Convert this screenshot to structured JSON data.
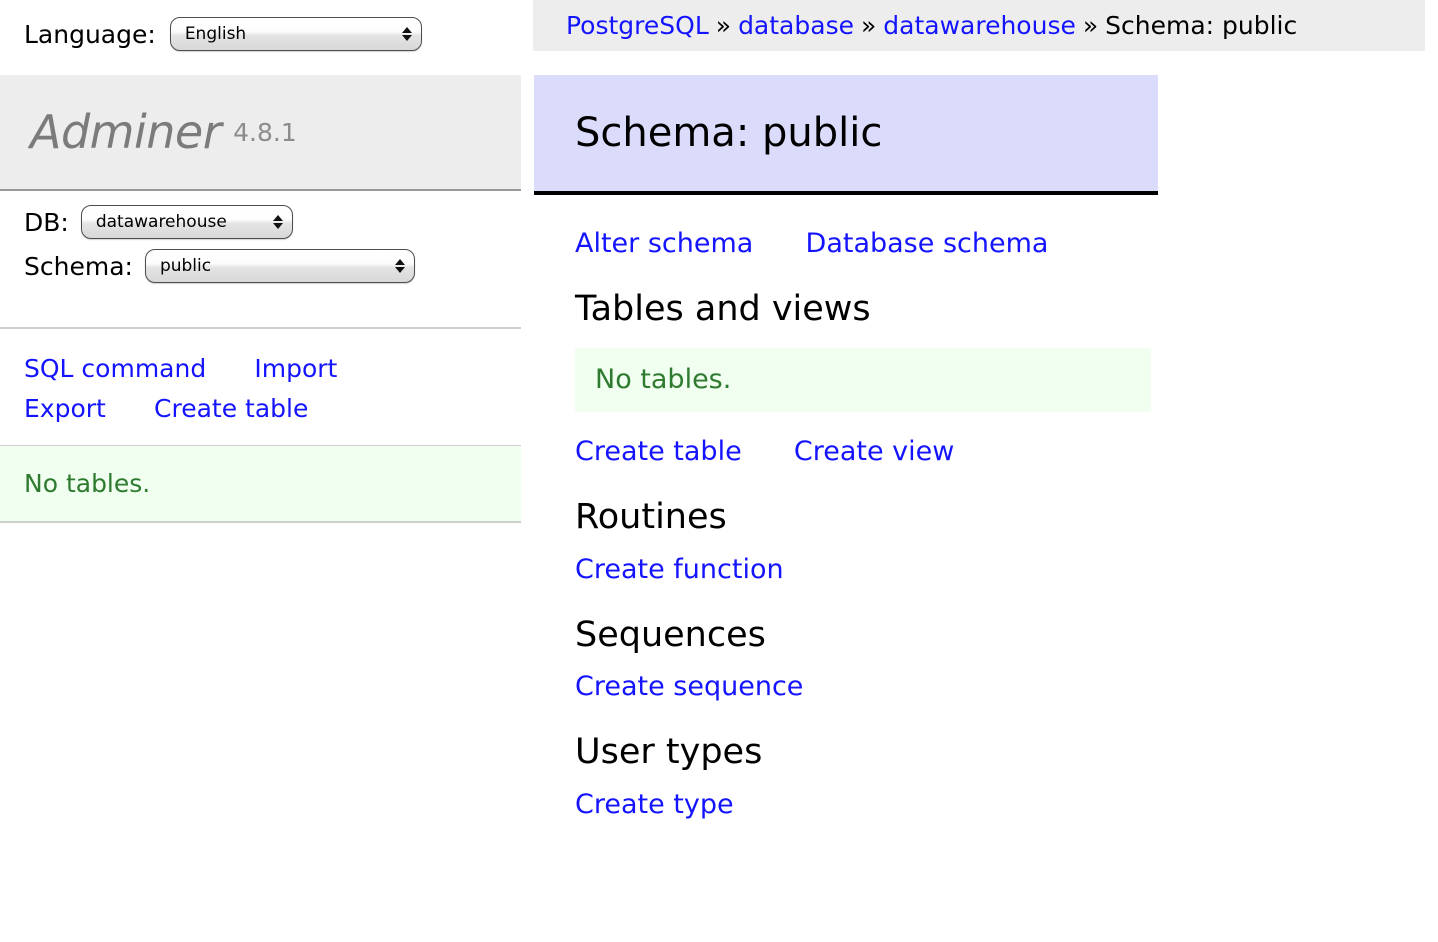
{
  "language_bar": {
    "label": "Language:",
    "select": {
      "value": "English",
      "icon": "updown-arrows-icon"
    }
  },
  "sidebar": {
    "brand": {
      "name": "Adminer",
      "version": "4.8.1"
    },
    "db": {
      "label": "DB:",
      "select": {
        "value": "datawarehouse",
        "icon": "updown-arrows-icon"
      }
    },
    "schema": {
      "label": "Schema:",
      "select": {
        "value": "public",
        "icon": "updown-arrows-icon"
      }
    },
    "links": [
      {
        "label": "SQL command"
      },
      {
        "label": "Import"
      },
      {
        "label": "Export"
      },
      {
        "label": "Create table"
      }
    ],
    "message": "No tables."
  },
  "breadcrumb": {
    "items": [
      {
        "label": "PostgreSQL",
        "link": true
      },
      {
        "label": "database",
        "link": true
      },
      {
        "label": "datawarehouse",
        "link": true
      },
      {
        "label": "Schema: public",
        "link": false
      }
    ],
    "separator": "»"
  },
  "main": {
    "title": "Schema: public",
    "top_links": [
      {
        "label": "Alter schema"
      },
      {
        "label": "Database schema"
      }
    ],
    "sections": [
      {
        "heading": "Tables and views",
        "message": "No tables.",
        "links": [
          {
            "label": "Create table"
          },
          {
            "label": "Create view"
          }
        ]
      },
      {
        "heading": "Routines",
        "links": [
          {
            "label": "Create function"
          }
        ]
      },
      {
        "heading": "Sequences",
        "links": [
          {
            "label": "Create sequence"
          }
        ]
      },
      {
        "heading": "User types",
        "links": [
          {
            "label": "Create type"
          }
        ]
      }
    ]
  },
  "colors": {
    "link": "#1414ff",
    "title_bg": "#dbdbfb",
    "panel_bg": "#ededed",
    "message_bg": "#f0fff0",
    "message_text": "#2e7a2e",
    "brand_text": "#7b7b7b"
  }
}
